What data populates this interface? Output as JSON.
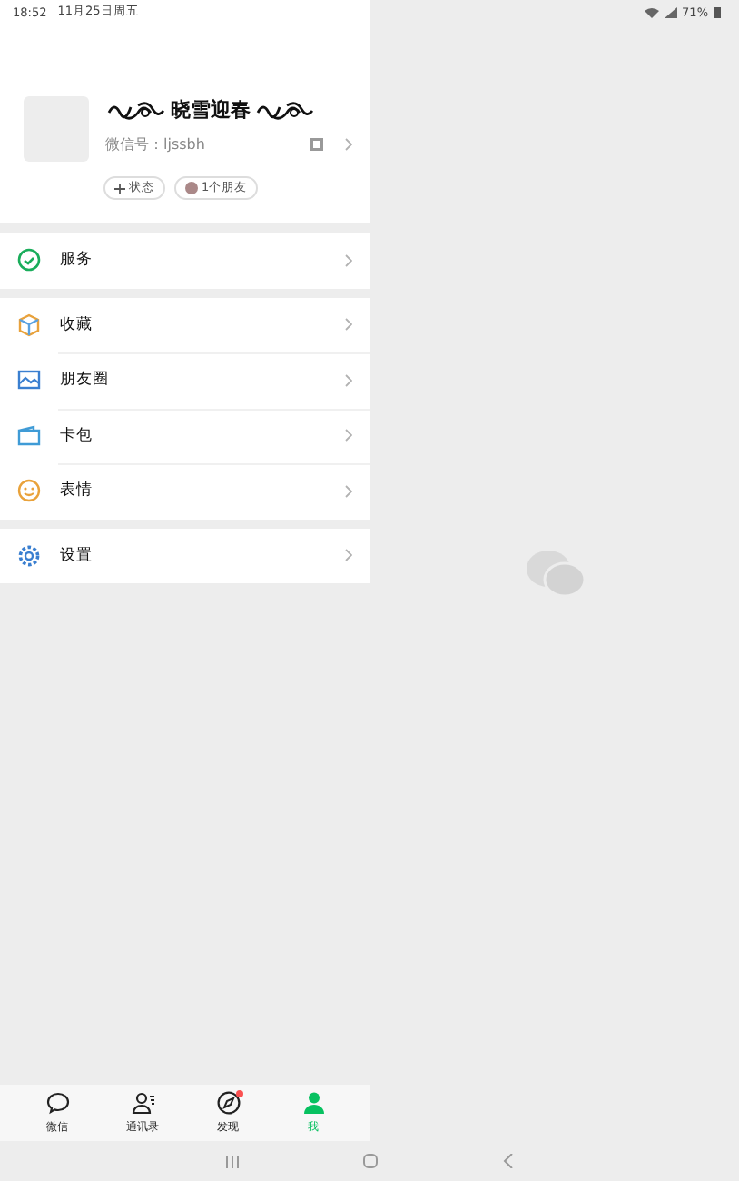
{
  "status_bar": {
    "time": "18:52",
    "date": "11月25日周五",
    "battery": "71%"
  },
  "profile": {
    "nickname": "晓雪迎春",
    "wechat_id_label": "微信号：",
    "wechat_id": "ljssbh",
    "chips": [
      {
        "kind": "status",
        "label": "状态"
      },
      {
        "kind": "friends",
        "label": "1个朋友"
      }
    ]
  },
  "menu_sections": [
    {
      "items": [
        {
          "kind": "service",
          "label": "服务"
        }
      ]
    },
    {
      "items": [
        {
          "kind": "favorites",
          "label": "收藏"
        },
        {
          "kind": "moments",
          "label": "朋友圈"
        },
        {
          "kind": "cards",
          "label": "卡包"
        },
        {
          "kind": "stickers",
          "label": "表情"
        }
      ]
    },
    {
      "items": [
        {
          "kind": "settings",
          "label": "设置"
        }
      ]
    }
  ],
  "tabs": [
    {
      "kind": "chats",
      "label": "微信",
      "selected": false,
      "dot": false
    },
    {
      "kind": "contacts",
      "label": "通讯录",
      "selected": false,
      "dot": false
    },
    {
      "kind": "discover",
      "label": "发现",
      "selected": false,
      "dot": true
    },
    {
      "kind": "me",
      "label": "我",
      "selected": true,
      "dot": false
    }
  ]
}
